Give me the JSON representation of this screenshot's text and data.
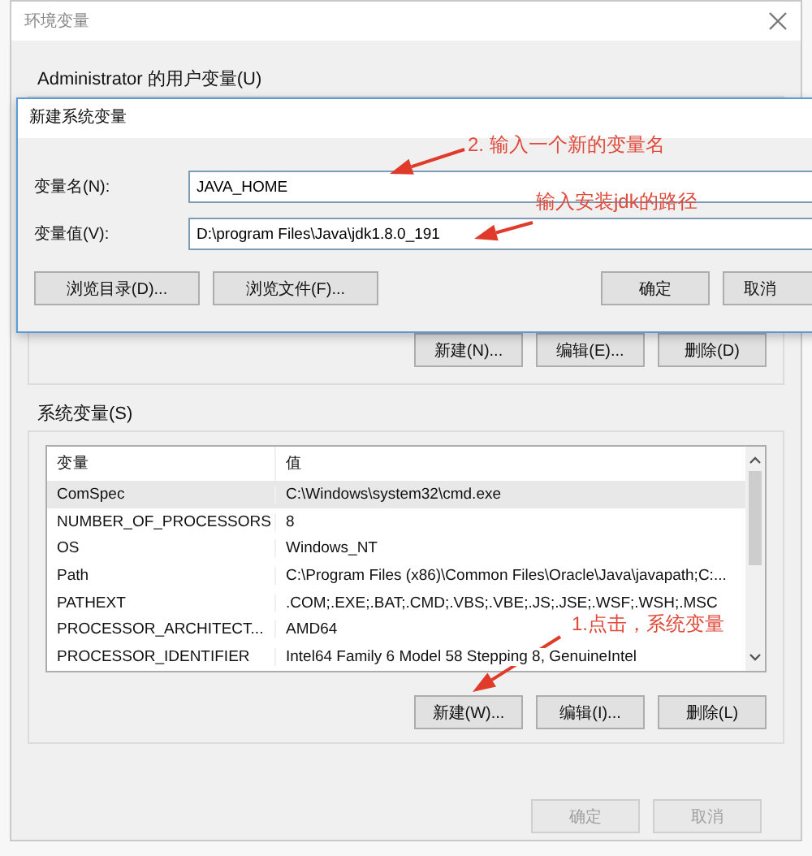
{
  "window": {
    "title": "环境变量"
  },
  "user_variables": {
    "label": "Administrator 的用户变量(U)",
    "buttons": [
      {
        "label": "新建(N)..."
      },
      {
        "label": "编辑(E)..."
      },
      {
        "label": "删除(D)"
      }
    ]
  },
  "system_variables": {
    "label": "系统变量(S)",
    "columns": [
      "变量",
      "值"
    ],
    "rows": [
      {
        "name": "ComSpec",
        "value": "C:\\Windows\\system32\\cmd.exe",
        "selected": true
      },
      {
        "name": "NUMBER_OF_PROCESSORS",
        "value": "8",
        "selected": false
      },
      {
        "name": "OS",
        "value": "Windows_NT",
        "selected": false
      },
      {
        "name": "Path",
        "value": "C:\\Program Files (x86)\\Common Files\\Oracle\\Java\\javapath;C:...",
        "selected": false
      },
      {
        "name": "PATHEXT",
        "value": ".COM;.EXE;.BAT;.CMD;.VBS;.VBE;.JS;.JSE;.WSF;.WSH;.MSC",
        "selected": false
      },
      {
        "name": "PROCESSOR_ARCHITECT...",
        "value": "AMD64",
        "selected": false
      },
      {
        "name": "PROCESSOR_IDENTIFIER",
        "value": "Intel64 Family 6 Model 58 Stepping 8, GenuineIntel",
        "selected": false
      }
    ],
    "buttons": [
      {
        "label": "新建(W)..."
      },
      {
        "label": "编辑(I)..."
      },
      {
        "label": "删除(L)"
      }
    ]
  },
  "footer_buttons": [
    {
      "label": "确定",
      "disabled": true
    },
    {
      "label": "取消",
      "disabled": true
    }
  ],
  "dialog": {
    "title": "新建系统变量",
    "fields": [
      {
        "label": "变量名(N):",
        "value": "JAVA_HOME"
      },
      {
        "label": "变量值(V):",
        "value": "D:\\program Files\\Java\\jdk1.8.0_191"
      }
    ],
    "buttons": [
      {
        "label": "浏览目录(D)..."
      },
      {
        "label": "浏览文件(F)..."
      },
      {
        "label": "确定"
      },
      {
        "label": "取消"
      }
    ]
  },
  "annotations": [
    {
      "text": "2. 输入一个新的变量名"
    },
    {
      "text": "输入安装jdk的路径"
    },
    {
      "text": "1.点击，系统变量"
    }
  ]
}
